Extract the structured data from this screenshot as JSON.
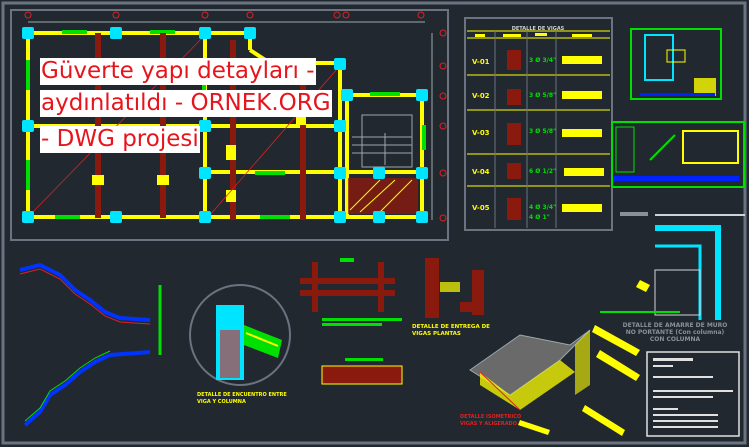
{
  "overlay": {
    "lines": [
      "Güverte yapı detayları -",
      "aydınlatıldı - ORNEK.ORG",
      "- DWG projesi"
    ],
    "text_color": "#e8141c",
    "background": "#ffffff"
  },
  "beam_table": {
    "title": "DETALLE DE VIGAS",
    "rows": [
      {
        "label": "V-01",
        "rebar": "3 Ø 3/4\""
      },
      {
        "label": "V-02",
        "rebar": "3 Ø 5/8\""
      },
      {
        "label": "V-03",
        "rebar": "3 Ø 5/8\""
      },
      {
        "label": "V-04",
        "rebar": "6 Ø 1/2\""
      },
      {
        "label": "V-05",
        "rebar": "4 Ø 3/4\"",
        "rebar2": "4 Ø 1\""
      }
    ]
  },
  "labels": {
    "joint": [
      "DETALLE DE ENCUENTRO ENTRE",
      "VIGA Y COLUMNA"
    ],
    "support": [
      "DETALLE DE ENTREGA DE",
      "VIGAS PLANTAS"
    ],
    "wall": [
      "DETALLE DE AMARRE DE MURO",
      "NO PORTANTE (Con columna)",
      "CON COLUMNA"
    ],
    "iso": [
      "DETALLE ISOMETRICO",
      "VIGAS Y ALIGERADO"
    ]
  },
  "colors": {
    "background": "#212830",
    "beam": "#ffff00",
    "column": "#00e5ff",
    "rebar": "#8b1a0e",
    "dim": "#ff2020",
    "accent": "#00ff00",
    "frame": "#6b7380"
  }
}
